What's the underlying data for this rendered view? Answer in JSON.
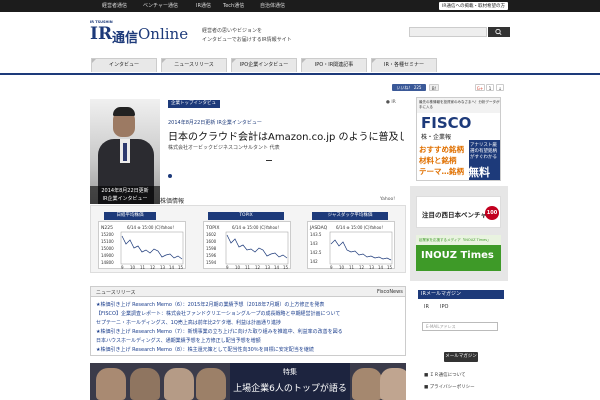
{
  "top_bar": {
    "links": [
      "経営者通信",
      "ベンチャー通信",
      "IR通信",
      "Tech通信",
      "自治体通信"
    ],
    "request_label": "IR通信への掲載・取材希望の方"
  },
  "logo": {
    "small_text": "IR TSUSHIN",
    "ir": "IR",
    "tsushin": "通信",
    "online": "Online"
  },
  "tagline": [
    "経営者の思いやビジョンを",
    "インタビューでお届けするIR情報サイト"
  ],
  "search": {
    "placeholder": "",
    "icon": "search-icon"
  },
  "nav": [
    "インタビュー",
    "ニュースリリース",
    "IPO企業インタビュー",
    "IPO・IR関連記事",
    "IR・各種セミナー"
  ],
  "social": {
    "like_label": "いいね！ 225",
    "gplus": "G+",
    "count": "1"
  },
  "feature": {
    "category": "企業トップインタビュー",
    "ir_mark": "IR",
    "date": "2014年8月22日更新",
    "date_link": "IR企業インタビュー",
    "headline": "日本のクラウド会計はAmazon.co.jp のように普及していくと考えています",
    "subhead": "株式会社オービックビジネスコンサルタント 代表",
    "dash": "—",
    "profile_caption_line1": "2014年8月22日更新",
    "profile_caption_line2": "IR企業インタビュー"
  },
  "stocks": {
    "title": "株価情報",
    "source": "Yahoo!",
    "charts": [
      {
        "label": "日経平均株価",
        "code": "N225",
        "time": "6/14 ⊕ 15:00 (C)Yahoo!",
        "y_ticks": [
          "15200",
          "15100",
          "15000",
          "14900",
          "14800"
        ],
        "x_ticks": [
          "9",
          "10",
          "11",
          "12",
          "13",
          "14",
          "15"
        ]
      },
      {
        "label": "TOPIX",
        "code": "TOPIX",
        "time": "6/14 ⊕ 15:00 (C)Yahoo!",
        "y_ticks": [
          "1602",
          "1600",
          "1598",
          "1596",
          "1594"
        ],
        "x_ticks": [
          "9",
          "10",
          "11",
          "12",
          "13",
          "14",
          "15"
        ]
      },
      {
        "label": "ジャスダック平均株価",
        "code": "JASDAQ",
        "time": "6/14 ⊕ 15:00 (C)Yahoo!",
        "y_ticks": [
          "143.5",
          "143",
          "142.5",
          "142"
        ],
        "x_ticks": [
          "9",
          "10",
          "11",
          "12",
          "13",
          "14",
          "15"
        ]
      }
    ]
  },
  "news": {
    "title": "ニュースリリース",
    "source": "FiscoNews",
    "items": [
      "★株価引き上げ Research Memo（6）：2015年2月期の業績予想（2018年7月期）の上方修正を発表",
      "【FISCO】企業調査レポート：株式会社ファンドクリエーショングループの成長戦略と中期経営計画について",
      "セプテーニ・ホールディングス、1Q売上高は前年比2ケタ増、利益は計画通り進捗",
      "★株価引き上げ Research Memo（7）：新規事業の立ち上げに向けた取り組みを推進中、利益率の改善を図る",
      "日本ハウスホールディングス、通期業績予想を上方修正し配当予想を増額",
      "★株価引き上げ Research Memo（8）：株主還元策として配当性向30％を目標に安定配当を継続"
    ]
  },
  "special": {
    "title1": "特集",
    "title2": "上場企業6人のトップが語る"
  },
  "ads": {
    "fisco_top": "最先の株情報を投資家のみなさまへ！分析データが手に入る",
    "fisco_logo": "FISCO",
    "fisco_sub": "株・企業報",
    "fisco_line1": "おすすめ銘柄",
    "fisco_line2": "材料と銘柄",
    "fisco_line3": "テーマ…銘柄",
    "fisco_analyst": "アナリスト厳選の有望銘柄がすぐわかる",
    "fisco_free": "無料",
    "nishinihon_label": "注目の西日本ベンチャー",
    "nishinihon_num": "100",
    "inouz_tiny": "起業家を応援するメディア「INOUZ Times」",
    "inouz_label": "INOUZ Times"
  },
  "ir_panel": {
    "header": "IRメールマガジン",
    "tabs": [
      "IR",
      "IPO"
    ],
    "email_placeholder": "E-MAILアドレス",
    "register_label": "メールマガジン登録",
    "lines": [
      "■ ＩＲ通信について",
      "■ プライバシーポリシー"
    ]
  }
}
